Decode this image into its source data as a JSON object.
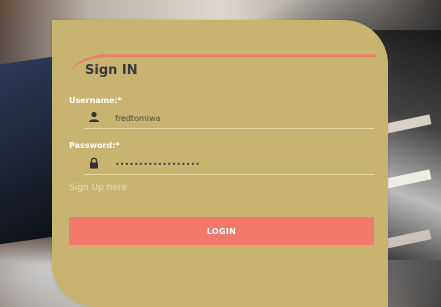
{
  "form": {
    "title": "Sign IN",
    "username": {
      "label": "Username:*",
      "value": "fredtomiwa",
      "icon": "user-icon"
    },
    "password": {
      "label": "Password:*",
      "value": "fredtomiwa12345678",
      "icon": "lock-icon"
    },
    "signup_link": "Sign Up here",
    "login_button": "LOGIN"
  },
  "colors": {
    "card": "#c9b370",
    "accent": "#e7826c",
    "button": "#f27a6a"
  }
}
